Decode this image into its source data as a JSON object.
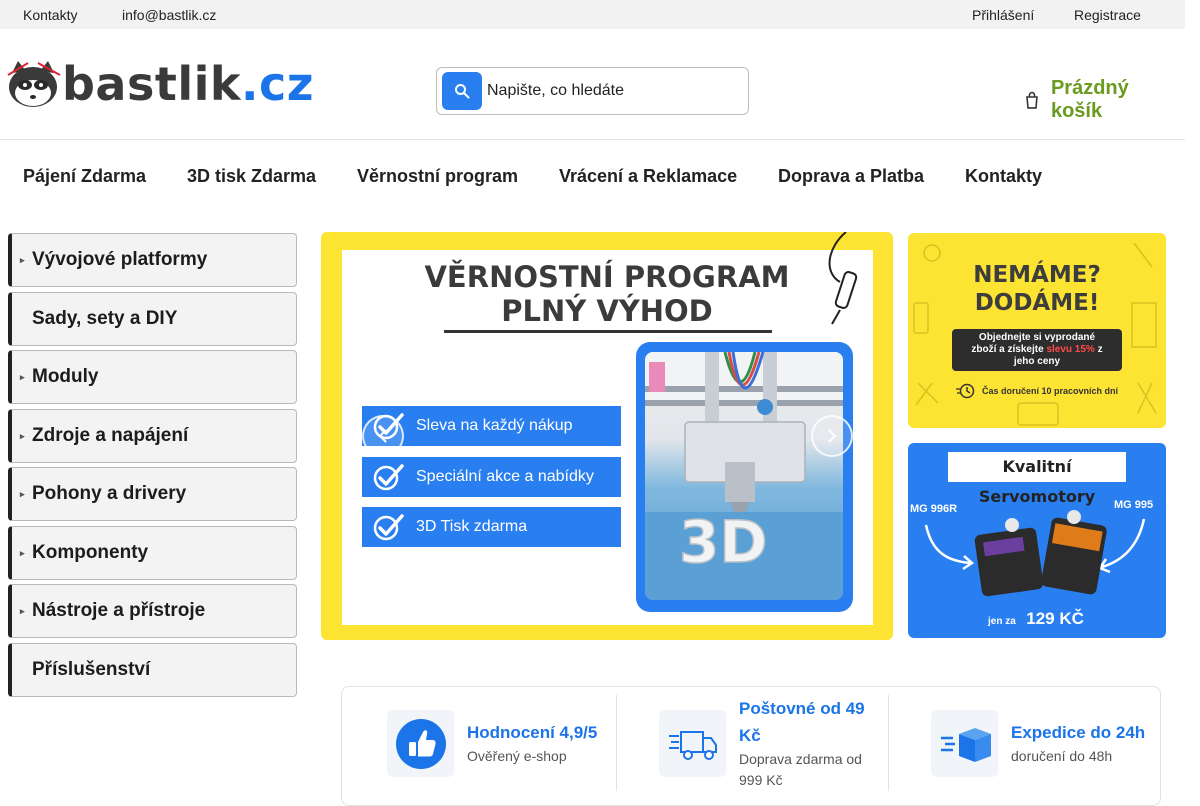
{
  "topbar": {
    "contacts_label": "Kontakty",
    "email": "info@bastlik.cz",
    "login_label": "Přihlášení",
    "register_label": "Registrace"
  },
  "header": {
    "logo_main": "bastlik",
    "logo_tld": ".cz",
    "search_placeholder": "Napište, co hledáte",
    "search_value": "",
    "cart_label": "Prázdný košík"
  },
  "nav": {
    "items": [
      "Pájení Zdarma",
      "3D tisk Zdarma",
      "Věrnostní program",
      "Vrácení a Reklamace",
      "Doprava a Platba",
      "Kontakty"
    ]
  },
  "sidebar": {
    "categories": [
      {
        "label": "Vývojové platformy",
        "has_arrow": true
      },
      {
        "label": "Sady, sety a DIY",
        "has_arrow": false
      },
      {
        "label": "Moduly",
        "has_arrow": true
      },
      {
        "label": "Zdroje a napájení",
        "has_arrow": true
      },
      {
        "label": "Pohony a drivery",
        "has_arrow": true
      },
      {
        "label": "Komponenty",
        "has_arrow": true
      },
      {
        "label": "Nástroje a přístroje",
        "has_arrow": true
      },
      {
        "label": "Příslušenství",
        "has_arrow": false
      }
    ]
  },
  "hero": {
    "title_line1": "VĚRNOSTNÍ PROGRAM",
    "title_line2": "PLNÝ VÝHOD",
    "benefits": [
      "Sleva na každý nákup",
      "Speciální akce a nabídky",
      "3D Tisk zdarma"
    ]
  },
  "promo_out_of_stock": {
    "line1": "NEMÁME?",
    "line2": "DODÁME!",
    "text_a": "Objednejte si vyprodané",
    "text_b": "zboží a získejte",
    "discount": "slevu 15%",
    "text_c": "z",
    "text_d": "jeho ceny",
    "delivery": "Čas doručení 10 pracovních dní"
  },
  "promo_servo": {
    "title": "Kvalitní Servomotory",
    "model_left": "MG 996R",
    "model_right": "MG 995",
    "price_prefix": "jen za",
    "price": "129 KČ"
  },
  "features": [
    {
      "title": "Hodnocení 4,9/5",
      "subtitle": "Ověřený e-shop",
      "icon": "thumbs-up-icon"
    },
    {
      "title": "Poštovné od 49 Kč",
      "subtitle": "Doprava zdarma od 999 Kč",
      "icon": "delivery-truck-icon"
    },
    {
      "title": "Expedice do 24h",
      "subtitle": "doručení do 48h",
      "icon": "fast-package-icon"
    }
  ],
  "colors": {
    "brand_blue": "#2a7ff0",
    "cart_green": "#6a9a1f",
    "promo_yellow": "#fde432"
  }
}
